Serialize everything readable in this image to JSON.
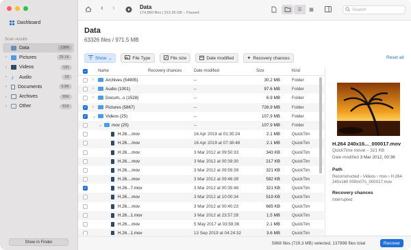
{
  "sidebar": {
    "dashboard_label": "Dashboard",
    "scan_results_label": "Scan results",
    "items": [
      {
        "label": "Data",
        "badge": "138K",
        "icon": "data-icon",
        "color": "#6b8fb8"
      },
      {
        "label": "Pictures",
        "badge": "25.1K",
        "icon": "pictures-icon",
        "color": "#4c9be8"
      },
      {
        "label": "Videos",
        "badge": "191",
        "icon": "videos-icon",
        "color": "#2c4a6a"
      },
      {
        "label": "Audio",
        "badge": "1K",
        "icon": "audio-icon",
        "color": "#1e6fd9"
      },
      {
        "label": "Documents",
        "badge": "5.8K",
        "icon": "documents-icon",
        "color": "#5a7ea8"
      },
      {
        "label": "Archives",
        "badge": "55K",
        "icon": "archives-icon",
        "color": "#5a7ea8"
      },
      {
        "label": "Other",
        "badge": "51K",
        "icon": "other-icon",
        "color": "#7a8fa8"
      }
    ],
    "show_in_finder": "Show in Finder"
  },
  "toolbar": {
    "title": "Data",
    "subtitle": "174,860 files | 313.36 GB – Paused",
    "search_placeholder": "Search"
  },
  "main": {
    "title": "Data",
    "subtitle": "63326 files / 971.5 MB"
  },
  "filters": {
    "show": "Show",
    "file_type": "File Type",
    "file_size": "File size",
    "date_modified": "Date modified",
    "recovery_chances": "Recovery chances",
    "reset_all": "Reset all"
  },
  "table": {
    "columns": {
      "name": "Name",
      "recovery": "Recovery chances",
      "date": "Date modified",
      "size": "Size",
      "kind": "Kind"
    },
    "rows": [
      {
        "level": 0,
        "type": "folder",
        "name": "Archives (54905)",
        "date": "--",
        "size": "30.2 MB",
        "kind": "Folder",
        "checked": false
      },
      {
        "level": 0,
        "type": "folder",
        "name": "Audio (1001)",
        "date": "--",
        "size": "97.6 MB",
        "kind": "Folder",
        "checked": false
      },
      {
        "level": 0,
        "type": "folder",
        "name": "Docum...s (1528)",
        "date": "--",
        "size": "6.9 MB",
        "kind": "Folder",
        "checked": false
      },
      {
        "level": 0,
        "type": "folder",
        "name": "Pictures (5867)",
        "date": "--",
        "size": "728.9 MB",
        "kind": "Folder",
        "checked": true
      },
      {
        "level": 0,
        "type": "folder",
        "name": "Videos (25)",
        "date": "--",
        "size": "107.9 MB",
        "kind": "Folder",
        "checked": true,
        "open": true
      },
      {
        "level": 1,
        "type": "folder",
        "name": "mov (25)",
        "date": "--",
        "size": "107.9 MB",
        "kind": "Folder",
        "checked": false,
        "open": true
      },
      {
        "level": 2,
        "type": "file",
        "name": "H.26....mov",
        "date": "16 Apr 2019 at 01:35:24",
        "size": "2.1 MB",
        "kind": "QuickTim",
        "checked": false
      },
      {
        "level": 2,
        "type": "file",
        "name": "H.26....mov",
        "date": "16 Apr 2019 at 07:38:48",
        "size": "2.1 MB",
        "kind": "QuickTim",
        "checked": false
      },
      {
        "level": 2,
        "type": "file",
        "name": "H.26....mov",
        "date": "3 Mar 2012 at 09:50:33",
        "size": "343 KB",
        "kind": "QuickTim",
        "checked": false
      },
      {
        "level": 2,
        "type": "file",
        "name": "H.26....mov",
        "date": "3 Mar 2012 at 00:39:30",
        "size": "217 KB",
        "kind": "QuickTim",
        "checked": false
      },
      {
        "level": 2,
        "type": "file",
        "name": "H.26....mov",
        "date": "3 Mar 2012 at 09:59:39",
        "size": "321 KB",
        "kind": "QuickTim",
        "checked": false
      },
      {
        "level": 2,
        "type": "file",
        "name": "H.26....mov",
        "date": "3 Mar 2012 at 09:46:39",
        "size": "592 KB",
        "kind": "QuickTim",
        "checked": false
      },
      {
        "level": 2,
        "type": "file",
        "name": "H.26...7.mov",
        "date": "3 Mar 2012 at 00:35:48",
        "size": "321 KB",
        "kind": "QuickTim",
        "checked": true
      },
      {
        "level": 2,
        "type": "file",
        "name": "H.26....mov",
        "date": "3 Mar 2012 at 10:00:34",
        "size": "519 KB",
        "kind": "QuickTim",
        "checked": false
      },
      {
        "level": 2,
        "type": "file",
        "name": "H.26....mov",
        "date": "3 Mar 2012 at 00:40:23",
        "size": "665 KB",
        "kind": "QuickTim",
        "checked": false
      },
      {
        "level": 2,
        "type": "file",
        "name": "H.26...1.mov",
        "date": "3 Mar 2012 at 23:57:28",
        "size": "1.5 MB",
        "kind": "QuickTim",
        "checked": false
      },
      {
        "level": 2,
        "type": "file",
        "name": "H.26....mov",
        "date": "5 May 2017 at 03:58:36",
        "size": "2.1 MB",
        "kind": "QuickTim",
        "checked": false
      },
      {
        "level": 2,
        "type": "file",
        "name": "H.26...1.mov",
        "date": "13 Sep 2019 at 04:24:32",
        "size": "3.6 MB",
        "kind": "QuickTim",
        "checked": false
      },
      {
        "level": 2,
        "type": "file",
        "name": "H.26....mov",
        "date": "13 Sep 2019 at 05:50:19",
        "size": "3.6 MB",
        "kind": "QuickTim",
        "checked": false
      }
    ]
  },
  "preview": {
    "name": "H.264 240x16..._000017.mov",
    "type_size": "QuickTime movie – 321 KB",
    "date_label": "Date modified",
    "date_value": "3 Mar 2012, 00:36",
    "path_heading": "Path",
    "path_value": "Reconstructed › Videos › mov › H.264 240x160 000m07s_000017.mov",
    "recovery_heading": "Recovery chances",
    "recovery_value": "Interrupted"
  },
  "status": {
    "summary": "5868 files (729.3 MB) selected, 137998 files total",
    "recover": "Recover"
  },
  "colors": {
    "accent": "#1e6fd9",
    "sidebar_bg": "#e6e3e5",
    "traffic_red": "#fe5f57",
    "traffic_yellow": "#febc2e",
    "traffic_green": "#28c840"
  }
}
